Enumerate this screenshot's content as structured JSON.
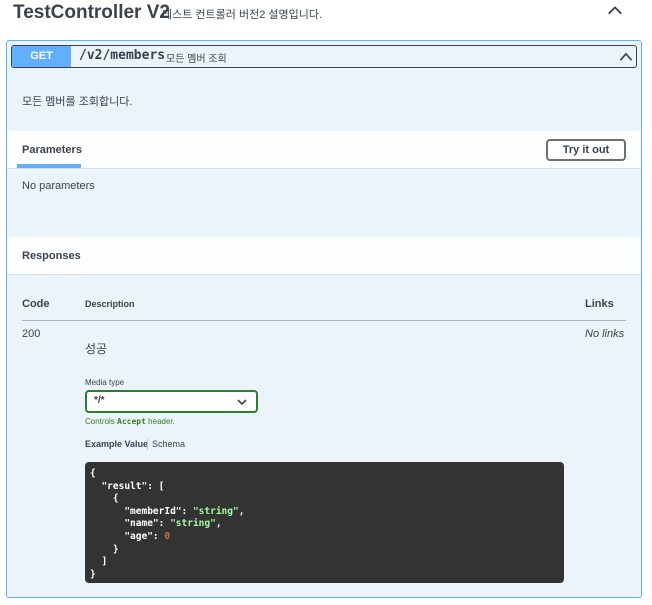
{
  "tag": {
    "title": "TestController V2",
    "description": "테스트 컨트롤러 버전2 설명입니다."
  },
  "operation": {
    "method": "GET",
    "path": "/v2/members",
    "summary": "모든 멤버 조회",
    "description": "모든 멤버를 조회합니다."
  },
  "parameters": {
    "title": "Parameters",
    "try_label": "Try it out",
    "empty_text": "No parameters"
  },
  "responses": {
    "title": "Responses",
    "headers": {
      "code": "Code",
      "description": "Description",
      "links": "Links"
    },
    "rows": [
      {
        "code": "200",
        "description": "성공",
        "links": "No links",
        "media_type_label": "Media type",
        "media_type_value": "*/*",
        "controls_prefix": "Controls",
        "controls_code": "Accept",
        "controls_suffix": "header.",
        "example_tab": "Example Value",
        "schema_tab": "Schema",
        "example": [
          "{",
          "  \"result\": [",
          "    {",
          "      \"memberId\": \"string\",",
          "      \"name\": \"string\",",
          "      \"age\": 0",
          "    }",
          "  ]",
          "}"
        ]
      }
    ]
  },
  "colors": {
    "get": "#61affe",
    "code_bg": "#333333",
    "media_border": "#2e7d32"
  },
  "icons": {
    "collapse": "chevron-up-icon",
    "summary_toggle": "chevron-up-icon",
    "select": "chevron-down-icon"
  }
}
